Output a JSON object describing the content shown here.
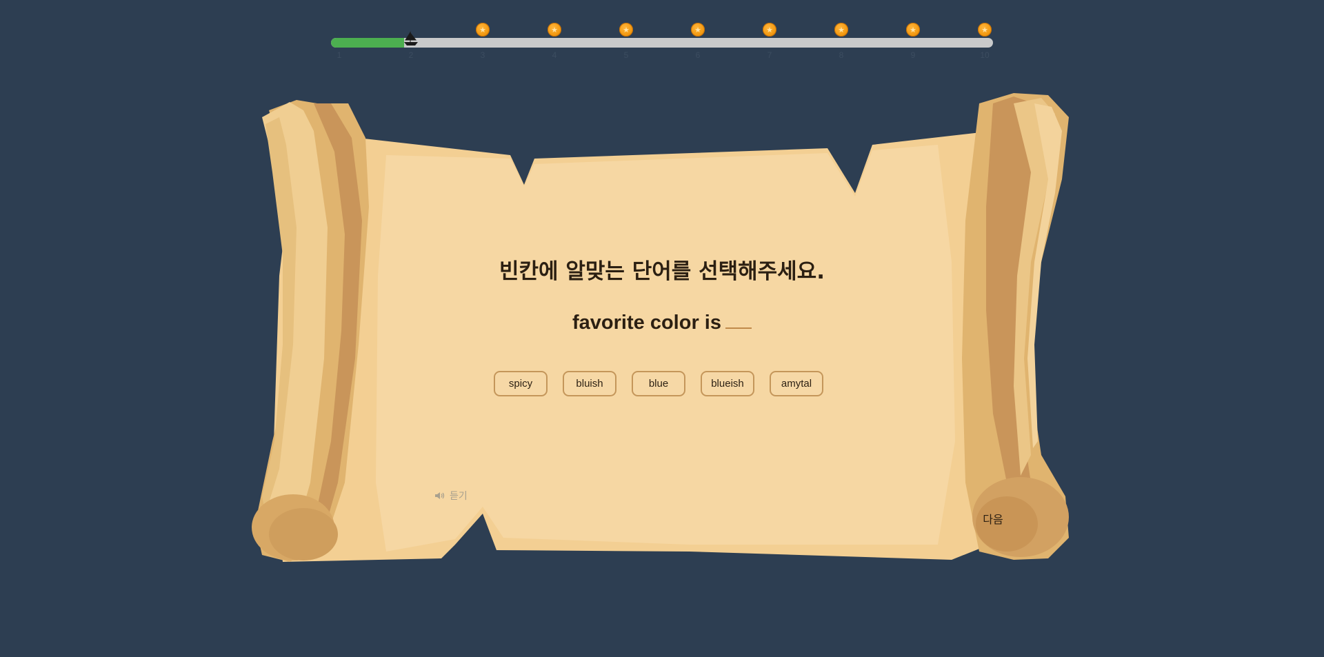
{
  "progress": {
    "current": 2,
    "total": 10,
    "filled_fraction": 0.11,
    "ticks": [
      "1",
      "2",
      "3",
      "4",
      "5",
      "6",
      "7",
      "8",
      "9",
      "10"
    ],
    "coin_steps": [
      3,
      4,
      5,
      6,
      7,
      8,
      9,
      10
    ],
    "colors": {
      "fill": "#4caf50",
      "track": "#c9cacb",
      "coin": "#f39a12"
    }
  },
  "question": {
    "instruction": "빈칸에 알맞는 단어를 선택해주세요.",
    "sentence": "favorite color is"
  },
  "options": [
    "spicy",
    "bluish",
    "blue",
    "blueish",
    "amytal"
  ],
  "controls": {
    "listen_label": "듣기",
    "next_label": "다음"
  },
  "icons": {
    "ship": "ship-icon",
    "coin": "coin-icon",
    "speaker": "speaker-icon"
  }
}
